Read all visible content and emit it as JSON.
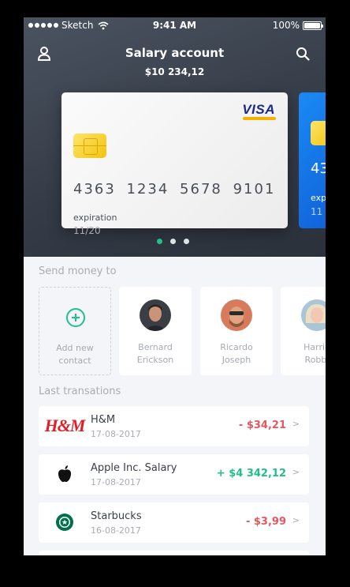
{
  "status_bar": {
    "carrier": "Sketch",
    "time": "9:41 AM",
    "battery": "100%"
  },
  "header": {
    "title": "Salary account",
    "balance": "$10 234,12",
    "icons": {
      "left": "user-icon",
      "right": "search-icon"
    }
  },
  "card": {
    "brand": "VISA",
    "number": "4363 1234 5678 9101",
    "expiration_label": "expiration",
    "expiration_value": "11/20"
  },
  "next_card": {
    "number_partial": "43",
    "expiration_label_partial": "exp",
    "expiration_value_partial": "11"
  },
  "pager": {
    "count": 3,
    "active": 0
  },
  "send_money": {
    "title": "Send money to",
    "add_label_line1": "Add new",
    "add_label_line2": "contact",
    "contacts": [
      {
        "first": "Bernard",
        "last": "Erickson"
      },
      {
        "first": "Ricardo",
        "last": "Joseph"
      },
      {
        "first": "Harrie",
        "last": "Robbi"
      }
    ]
  },
  "transactions": {
    "title": "Last transations",
    "items": [
      {
        "name": "H&M",
        "date": "17-08-2017",
        "amount": "- $34,21",
        "kind": "neg",
        "logo": "hm-logo",
        "logo_text": "H&M"
      },
      {
        "name": "Apple Inc. Salary",
        "date": "17-08-2017",
        "amount": "+ $4 342,12",
        "kind": "pos",
        "logo": "apple-icon"
      },
      {
        "name": "Starbucks",
        "date": "16-08-2017",
        "amount": "- $3,99",
        "kind": "neg",
        "logo": "starbucks-icon"
      }
    ],
    "chevron": ">"
  },
  "colors": {
    "accent": "#21c08b",
    "negative": "#e6585f",
    "header_bg": "#353c47",
    "next_card": "#1a8af5"
  }
}
